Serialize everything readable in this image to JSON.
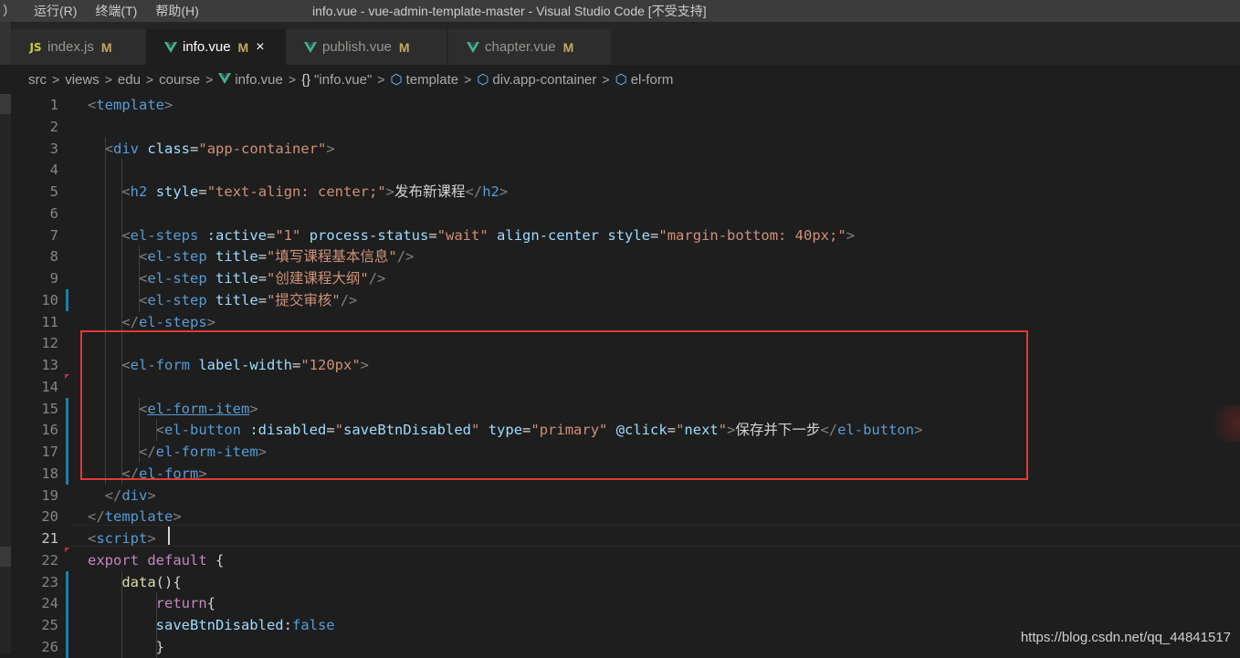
{
  "window": {
    "menu": [
      "）",
      "运行(R)",
      "终端(T)",
      "帮助(H)"
    ],
    "title": "info.vue - vue-admin-template-master - Visual Studio Code [不受支持]"
  },
  "tabs": [
    {
      "label": "index.js",
      "icon": "js-file-icon",
      "icon_text": "JS",
      "status": "M",
      "active": false
    },
    {
      "label": "info.vue",
      "icon": "vue-file-icon",
      "status": "M",
      "active": true,
      "close": "×"
    },
    {
      "label": "publish.vue",
      "icon": "vue-file-icon",
      "status": "M",
      "active": false
    },
    {
      "label": "chapter.vue",
      "icon": "vue-file-icon",
      "status": "M",
      "active": false
    }
  ],
  "breadcrumb": [
    "src",
    "views",
    "edu",
    "course",
    "info.vue",
    "\"info.vue\"",
    "template",
    "div.app-container",
    "el-form"
  ],
  "breadcrumb_symbols": {
    "object": "{}",
    "element": "⬡"
  },
  "editor": {
    "current_line": 21,
    "lines": [
      {
        "n": "1",
        "tokens": [
          [
            "p",
            "<"
          ],
          [
            "t",
            "template"
          ],
          [
            "p",
            ">"
          ]
        ]
      },
      {
        "n": "2",
        "tokens": []
      },
      {
        "n": "3",
        "tokens": [
          [
            "x",
            "  "
          ],
          [
            "p",
            "<"
          ],
          [
            "t",
            "div"
          ],
          [
            "x",
            " "
          ],
          [
            "a",
            "class"
          ],
          [
            "x",
            "="
          ],
          [
            "s",
            "\"app-container\""
          ],
          [
            "p",
            ">"
          ]
        ]
      },
      {
        "n": "4",
        "tokens": []
      },
      {
        "n": "5",
        "tokens": [
          [
            "x",
            "    "
          ],
          [
            "p",
            "<"
          ],
          [
            "t",
            "h2"
          ],
          [
            "x",
            " "
          ],
          [
            "a",
            "style"
          ],
          [
            "x",
            "="
          ],
          [
            "s",
            "\"text-align: center;\""
          ],
          [
            "p",
            ">"
          ],
          [
            "x",
            "发布新课程"
          ],
          [
            "p",
            "</"
          ],
          [
            "t",
            "h2"
          ],
          [
            "p",
            ">"
          ]
        ]
      },
      {
        "n": "6",
        "tokens": []
      },
      {
        "n": "7",
        "tokens": [
          [
            "x",
            "    "
          ],
          [
            "p",
            "<"
          ],
          [
            "t",
            "el-steps"
          ],
          [
            "x",
            " "
          ],
          [
            "a",
            ":active"
          ],
          [
            "x",
            "="
          ],
          [
            "s",
            "\"1\""
          ],
          [
            "x",
            " "
          ],
          [
            "a",
            "process-status"
          ],
          [
            "x",
            "="
          ],
          [
            "s",
            "\"wait\""
          ],
          [
            "x",
            " "
          ],
          [
            "a",
            "align-center"
          ],
          [
            "x",
            " "
          ],
          [
            "a",
            "style"
          ],
          [
            "x",
            "="
          ],
          [
            "s",
            "\"margin-bottom: 40px;\""
          ],
          [
            "p",
            ">"
          ]
        ]
      },
      {
        "n": "8",
        "tokens": [
          [
            "x",
            "      "
          ],
          [
            "p",
            "<"
          ],
          [
            "t",
            "el-step"
          ],
          [
            "x",
            " "
          ],
          [
            "a",
            "title"
          ],
          [
            "x",
            "="
          ],
          [
            "s",
            "\"填写课程基本信息\""
          ],
          [
            "p",
            "/>"
          ]
        ]
      },
      {
        "n": "9",
        "tokens": [
          [
            "x",
            "      "
          ],
          [
            "p",
            "<"
          ],
          [
            "t",
            "el-step"
          ],
          [
            "x",
            " "
          ],
          [
            "a",
            "title"
          ],
          [
            "x",
            "="
          ],
          [
            "s",
            "\"创建课程大纲\""
          ],
          [
            "p",
            "/>"
          ]
        ]
      },
      {
        "n": "10",
        "tokens": [
          [
            "x",
            "      "
          ],
          [
            "p",
            "<"
          ],
          [
            "t",
            "el-step"
          ],
          [
            "x",
            " "
          ],
          [
            "a",
            "title"
          ],
          [
            "x",
            "="
          ],
          [
            "s",
            "\"提交审核\""
          ],
          [
            "p",
            "/>"
          ]
        ]
      },
      {
        "n": "11",
        "tokens": [
          [
            "x",
            "    "
          ],
          [
            "p",
            "</"
          ],
          [
            "t",
            "el-steps"
          ],
          [
            "p",
            ">"
          ]
        ]
      },
      {
        "n": "12",
        "tokens": []
      },
      {
        "n": "13",
        "tokens": [
          [
            "x",
            "    "
          ],
          [
            "p",
            "<"
          ],
          [
            "t",
            "el-form"
          ],
          [
            "x",
            " "
          ],
          [
            "a",
            "label-width"
          ],
          [
            "x",
            "="
          ],
          [
            "s",
            "\"120px\""
          ],
          [
            "p",
            ">"
          ]
        ]
      },
      {
        "n": "14",
        "tokens": []
      },
      {
        "n": "15",
        "tokens": [
          [
            "x",
            "      "
          ],
          [
            "p",
            "<"
          ],
          [
            "tu",
            "el-form-item"
          ],
          [
            "p",
            ">"
          ]
        ]
      },
      {
        "n": "16",
        "tokens": [
          [
            "x",
            "        "
          ],
          [
            "p",
            "<"
          ],
          [
            "t",
            "el-button"
          ],
          [
            "x",
            " "
          ],
          [
            "a",
            ":disabled"
          ],
          [
            "x",
            "="
          ],
          [
            "s",
            "\""
          ],
          [
            "a",
            "saveBtnDisabled"
          ],
          [
            "s",
            "\""
          ],
          [
            "x",
            " "
          ],
          [
            "a",
            "type"
          ],
          [
            "x",
            "="
          ],
          [
            "s",
            "\"primary\""
          ],
          [
            "x",
            " "
          ],
          [
            "a",
            "@click"
          ],
          [
            "x",
            "="
          ],
          [
            "s",
            "\""
          ],
          [
            "a",
            "next"
          ],
          [
            "s",
            "\""
          ],
          [
            "p",
            ">"
          ],
          [
            "x",
            "保存并下一步"
          ],
          [
            "p",
            "</"
          ],
          [
            "t",
            "el-button"
          ],
          [
            "p",
            ">"
          ]
        ]
      },
      {
        "n": "17",
        "tokens": [
          [
            "x",
            "      "
          ],
          [
            "p",
            "</"
          ],
          [
            "t",
            "el-form-item"
          ],
          [
            "p",
            ">"
          ]
        ]
      },
      {
        "n": "18",
        "tokens": [
          [
            "x",
            "    "
          ],
          [
            "p",
            "</"
          ],
          [
            "t",
            "el-form"
          ],
          [
            "p",
            ">"
          ]
        ]
      },
      {
        "n": "19",
        "tokens": [
          [
            "x",
            "  "
          ],
          [
            "p",
            "</"
          ],
          [
            "t",
            "div"
          ],
          [
            "p",
            ">"
          ]
        ]
      },
      {
        "n": "20",
        "tokens": [
          [
            "p",
            "</"
          ],
          [
            "t",
            "template"
          ],
          [
            "p",
            ">"
          ]
        ]
      },
      {
        "n": "21",
        "tokens": [
          [
            "p",
            "<"
          ],
          [
            "t",
            "script"
          ],
          [
            "p",
            ">"
          ]
        ]
      },
      {
        "n": "22",
        "tokens": [
          [
            "k",
            "export"
          ],
          [
            "x",
            " "
          ],
          [
            "k",
            "default"
          ],
          [
            "x",
            " {"
          ]
        ]
      },
      {
        "n": "23",
        "tokens": [
          [
            "x",
            "    "
          ],
          [
            "f",
            "data"
          ],
          [
            "x",
            "(){"
          ]
        ]
      },
      {
        "n": "24",
        "tokens": [
          [
            "x",
            "        "
          ],
          [
            "k",
            "return"
          ],
          [
            "x",
            "{"
          ]
        ]
      },
      {
        "n": "25",
        "tokens": [
          [
            "x",
            "        "
          ],
          [
            "a",
            "saveBtnDisabled"
          ],
          [
            "x",
            ":"
          ],
          [
            "b",
            "false"
          ]
        ]
      },
      {
        "n": "26",
        "tokens": [
          [
            "x",
            "        }"
          ]
        ]
      }
    ]
  },
  "watermark": "https://blog.csdn.net/qq_44841517",
  "colors": {
    "highlight_box": "#e53935",
    "git_modified": "#1b81a8",
    "vue_icon": "#41b883"
  }
}
